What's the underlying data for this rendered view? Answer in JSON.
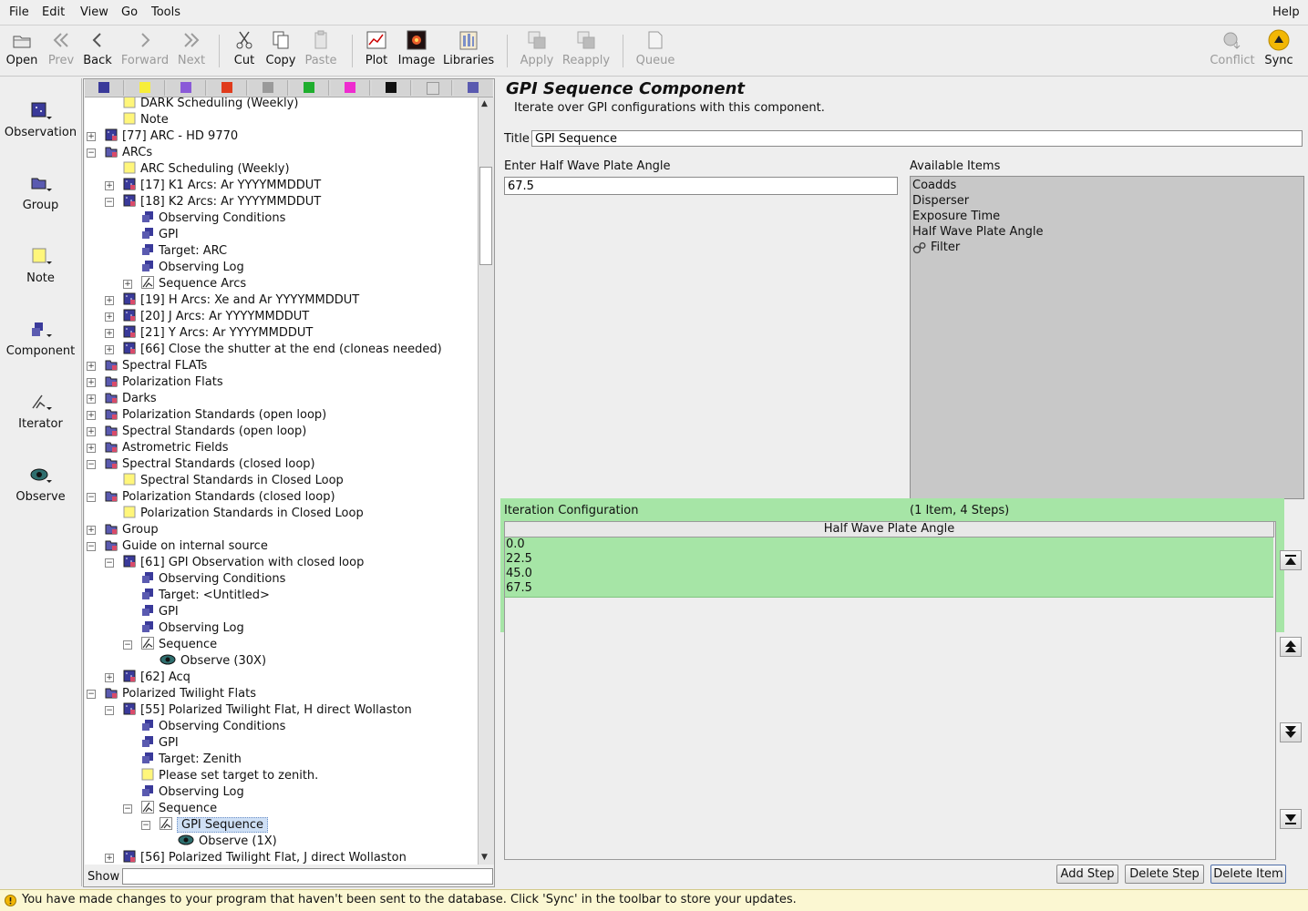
{
  "menubar": {
    "items": [
      "File",
      "Edit",
      "View",
      "Go",
      "Tools"
    ],
    "help": "Help"
  },
  "toolbar": {
    "open": "Open",
    "prev": "Prev",
    "back": "Back",
    "forward": "Forward",
    "next": "Next",
    "cut": "Cut",
    "copy": "Copy",
    "paste": "Paste",
    "plot": "Plot",
    "image": "Image",
    "libraries": "Libraries",
    "apply": "Apply",
    "reapply": "Reapply",
    "queue": "Queue",
    "conflict": "Conflict",
    "sync": "Sync"
  },
  "palette": {
    "observation": "Observation",
    "group": "Group",
    "note": "Note",
    "component": "Component",
    "iterator": "Iterator",
    "observe": "Observe"
  },
  "tree": {
    "rows": [
      {
        "label": "DARK Scheduling (Weekly)",
        "icon": "note"
      },
      {
        "label": "Note",
        "icon": "note"
      },
      {
        "label": "[77] ARC - HD 9770",
        "icon": "obs"
      },
      {
        "label": "ARCs",
        "icon": "group"
      },
      {
        "label": "ARC Scheduling (Weekly)",
        "icon": "note"
      },
      {
        "label": "[17] K1 Arcs: Ar YYYYMMDDUT",
        "icon": "obs"
      },
      {
        "label": "[18] K2 Arcs: Ar YYYYMMDDUT",
        "icon": "obs"
      },
      {
        "label": "Observing Conditions",
        "icon": "comp"
      },
      {
        "label": "GPI",
        "icon": "comp"
      },
      {
        "label": "Target: ARC",
        "icon": "comp"
      },
      {
        "label": "Observing Log",
        "icon": "comp"
      },
      {
        "label": "Sequence Arcs",
        "icon": "iter"
      },
      {
        "label": "[19] H Arcs: Xe and Ar YYYYMMDDUT",
        "icon": "obs"
      },
      {
        "label": "[20] J Arcs: Ar YYYYMMDDUT",
        "icon": "obs"
      },
      {
        "label": "[21] Y Arcs: Ar YYYYMMDDUT",
        "icon": "obs"
      },
      {
        "label": "[66] Close the shutter at the end (cloneas needed)",
        "icon": "obs"
      },
      {
        "label": "Spectral FLATs",
        "icon": "group"
      },
      {
        "label": "Polarization Flats",
        "icon": "group"
      },
      {
        "label": "Darks",
        "icon": "group"
      },
      {
        "label": "Polarization Standards (open loop)",
        "icon": "group"
      },
      {
        "label": "Spectral Standards (open loop)",
        "icon": "group"
      },
      {
        "label": "Astrometric Fields",
        "icon": "group"
      },
      {
        "label": "Spectral Standards (closed loop)",
        "icon": "group"
      },
      {
        "label": "Spectral Standards in Closed Loop",
        "icon": "note"
      },
      {
        "label": "Polarization Standards (closed loop)",
        "icon": "group"
      },
      {
        "label": "Polarization Standards in Closed Loop",
        "icon": "note"
      },
      {
        "label": "Group",
        "icon": "group"
      },
      {
        "label": "Guide on internal source",
        "icon": "group"
      },
      {
        "label": "[61] GPI Observation with closed loop",
        "icon": "obs"
      },
      {
        "label": "Observing Conditions",
        "icon": "comp"
      },
      {
        "label": "Target: <Untitled>",
        "icon": "comp"
      },
      {
        "label": "GPI",
        "icon": "comp"
      },
      {
        "label": "Observing Log",
        "icon": "comp"
      },
      {
        "label": "Sequence",
        "icon": "iter"
      },
      {
        "label": "Observe (30X)",
        "icon": "eye"
      },
      {
        "label": "[62] Acq",
        "icon": "obs"
      },
      {
        "label": "Polarized Twilight Flats",
        "icon": "group"
      },
      {
        "label": "[55] Polarized Twilight Flat, H direct Wollaston",
        "icon": "obs"
      },
      {
        "label": "Observing Conditions",
        "icon": "comp"
      },
      {
        "label": "GPI",
        "icon": "comp"
      },
      {
        "label": "Target: Zenith",
        "icon": "comp"
      },
      {
        "label": "Please set target to zenith.",
        "icon": "note"
      },
      {
        "label": "Observing Log",
        "icon": "comp"
      },
      {
        "label": "Sequence",
        "icon": "iter"
      },
      {
        "label": "GPI Sequence",
        "icon": "iter"
      },
      {
        "label": "Observe (1X)",
        "icon": "eye"
      },
      {
        "label": "[56] Polarized Twilight Flat, J direct Wollaston",
        "icon": "obs"
      }
    ],
    "show_label": "Show",
    "show_value": ""
  },
  "component": {
    "heading": "GPI Sequence Component",
    "description": "Iterate over GPI configurations with this component.",
    "title_label": "Title",
    "title_value": "GPI Sequence",
    "hwp_label": "Enter Half Wave Plate Angle",
    "hwp_value": "67.5",
    "available_label": "Available Items",
    "available_items": [
      "Coadds",
      "Disperser",
      "Exposure Time",
      "Half Wave Plate Angle",
      "Filter"
    ],
    "iteration_label": "Iteration Configuration",
    "iteration_summary": "(1 Item, 4 Steps)",
    "table_header": "Half Wave Plate Angle",
    "table_values": [
      "0.0",
      "22.5",
      "45.0",
      "67.5"
    ],
    "add_step": "Add Step",
    "delete_step": "Delete Step",
    "delete_item": "Delete Item"
  },
  "status": {
    "message": "You have made changes to your program that haven't been sent to the database.  Click 'Sync' in the toolbar to store your updates."
  },
  "colors": {
    "iteration_bg": "#a6e5a6",
    "status_bg": "#fbf7d2",
    "sync": "#f2b705",
    "selected": "#cfe0f5"
  }
}
